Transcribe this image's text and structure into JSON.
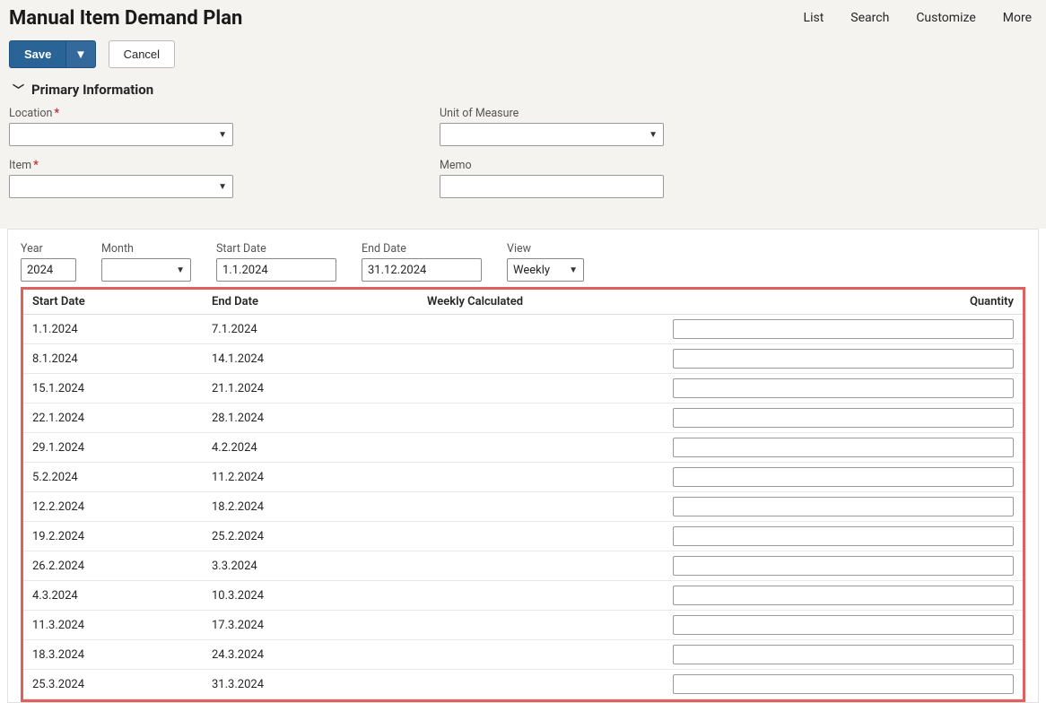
{
  "header": {
    "title": "Manual Item Demand Plan",
    "nav": {
      "list": "List",
      "search": "Search",
      "customize": "Customize",
      "more": "More"
    },
    "actions": {
      "save": "Save",
      "cancel": "Cancel"
    }
  },
  "section": {
    "primary": "Primary Information"
  },
  "form": {
    "location_label": "Location",
    "item_label": "Item",
    "uom_label": "Unit of Measure",
    "memo_label": "Memo",
    "location_value": "",
    "item_value": "",
    "uom_value": "",
    "memo_value": ""
  },
  "filters": {
    "year_label": "Year",
    "year_value": "2024",
    "month_label": "Month",
    "month_value": "",
    "start_label": "Start Date",
    "start_value": "1.1.2024",
    "end_label": "End Date",
    "end_value": "31.12.2024",
    "view_label": "View",
    "view_value": "Weekly"
  },
  "table": {
    "headers": {
      "start": "Start Date",
      "end": "End Date",
      "calc": "Weekly Calculated",
      "qty": "Quantity"
    },
    "rows": [
      {
        "start": "1.1.2024",
        "end": "7.1.2024"
      },
      {
        "start": "8.1.2024",
        "end": "14.1.2024"
      },
      {
        "start": "15.1.2024",
        "end": "21.1.2024"
      },
      {
        "start": "22.1.2024",
        "end": "28.1.2024"
      },
      {
        "start": "29.1.2024",
        "end": "4.2.2024"
      },
      {
        "start": "5.2.2024",
        "end": "11.2.2024"
      },
      {
        "start": "12.2.2024",
        "end": "18.2.2024"
      },
      {
        "start": "19.2.2024",
        "end": "25.2.2024"
      },
      {
        "start": "26.2.2024",
        "end": "3.3.2024"
      },
      {
        "start": "4.3.2024",
        "end": "10.3.2024"
      },
      {
        "start": "11.3.2024",
        "end": "17.3.2024"
      },
      {
        "start": "18.3.2024",
        "end": "24.3.2024"
      },
      {
        "start": "25.3.2024",
        "end": "31.3.2024"
      }
    ]
  }
}
